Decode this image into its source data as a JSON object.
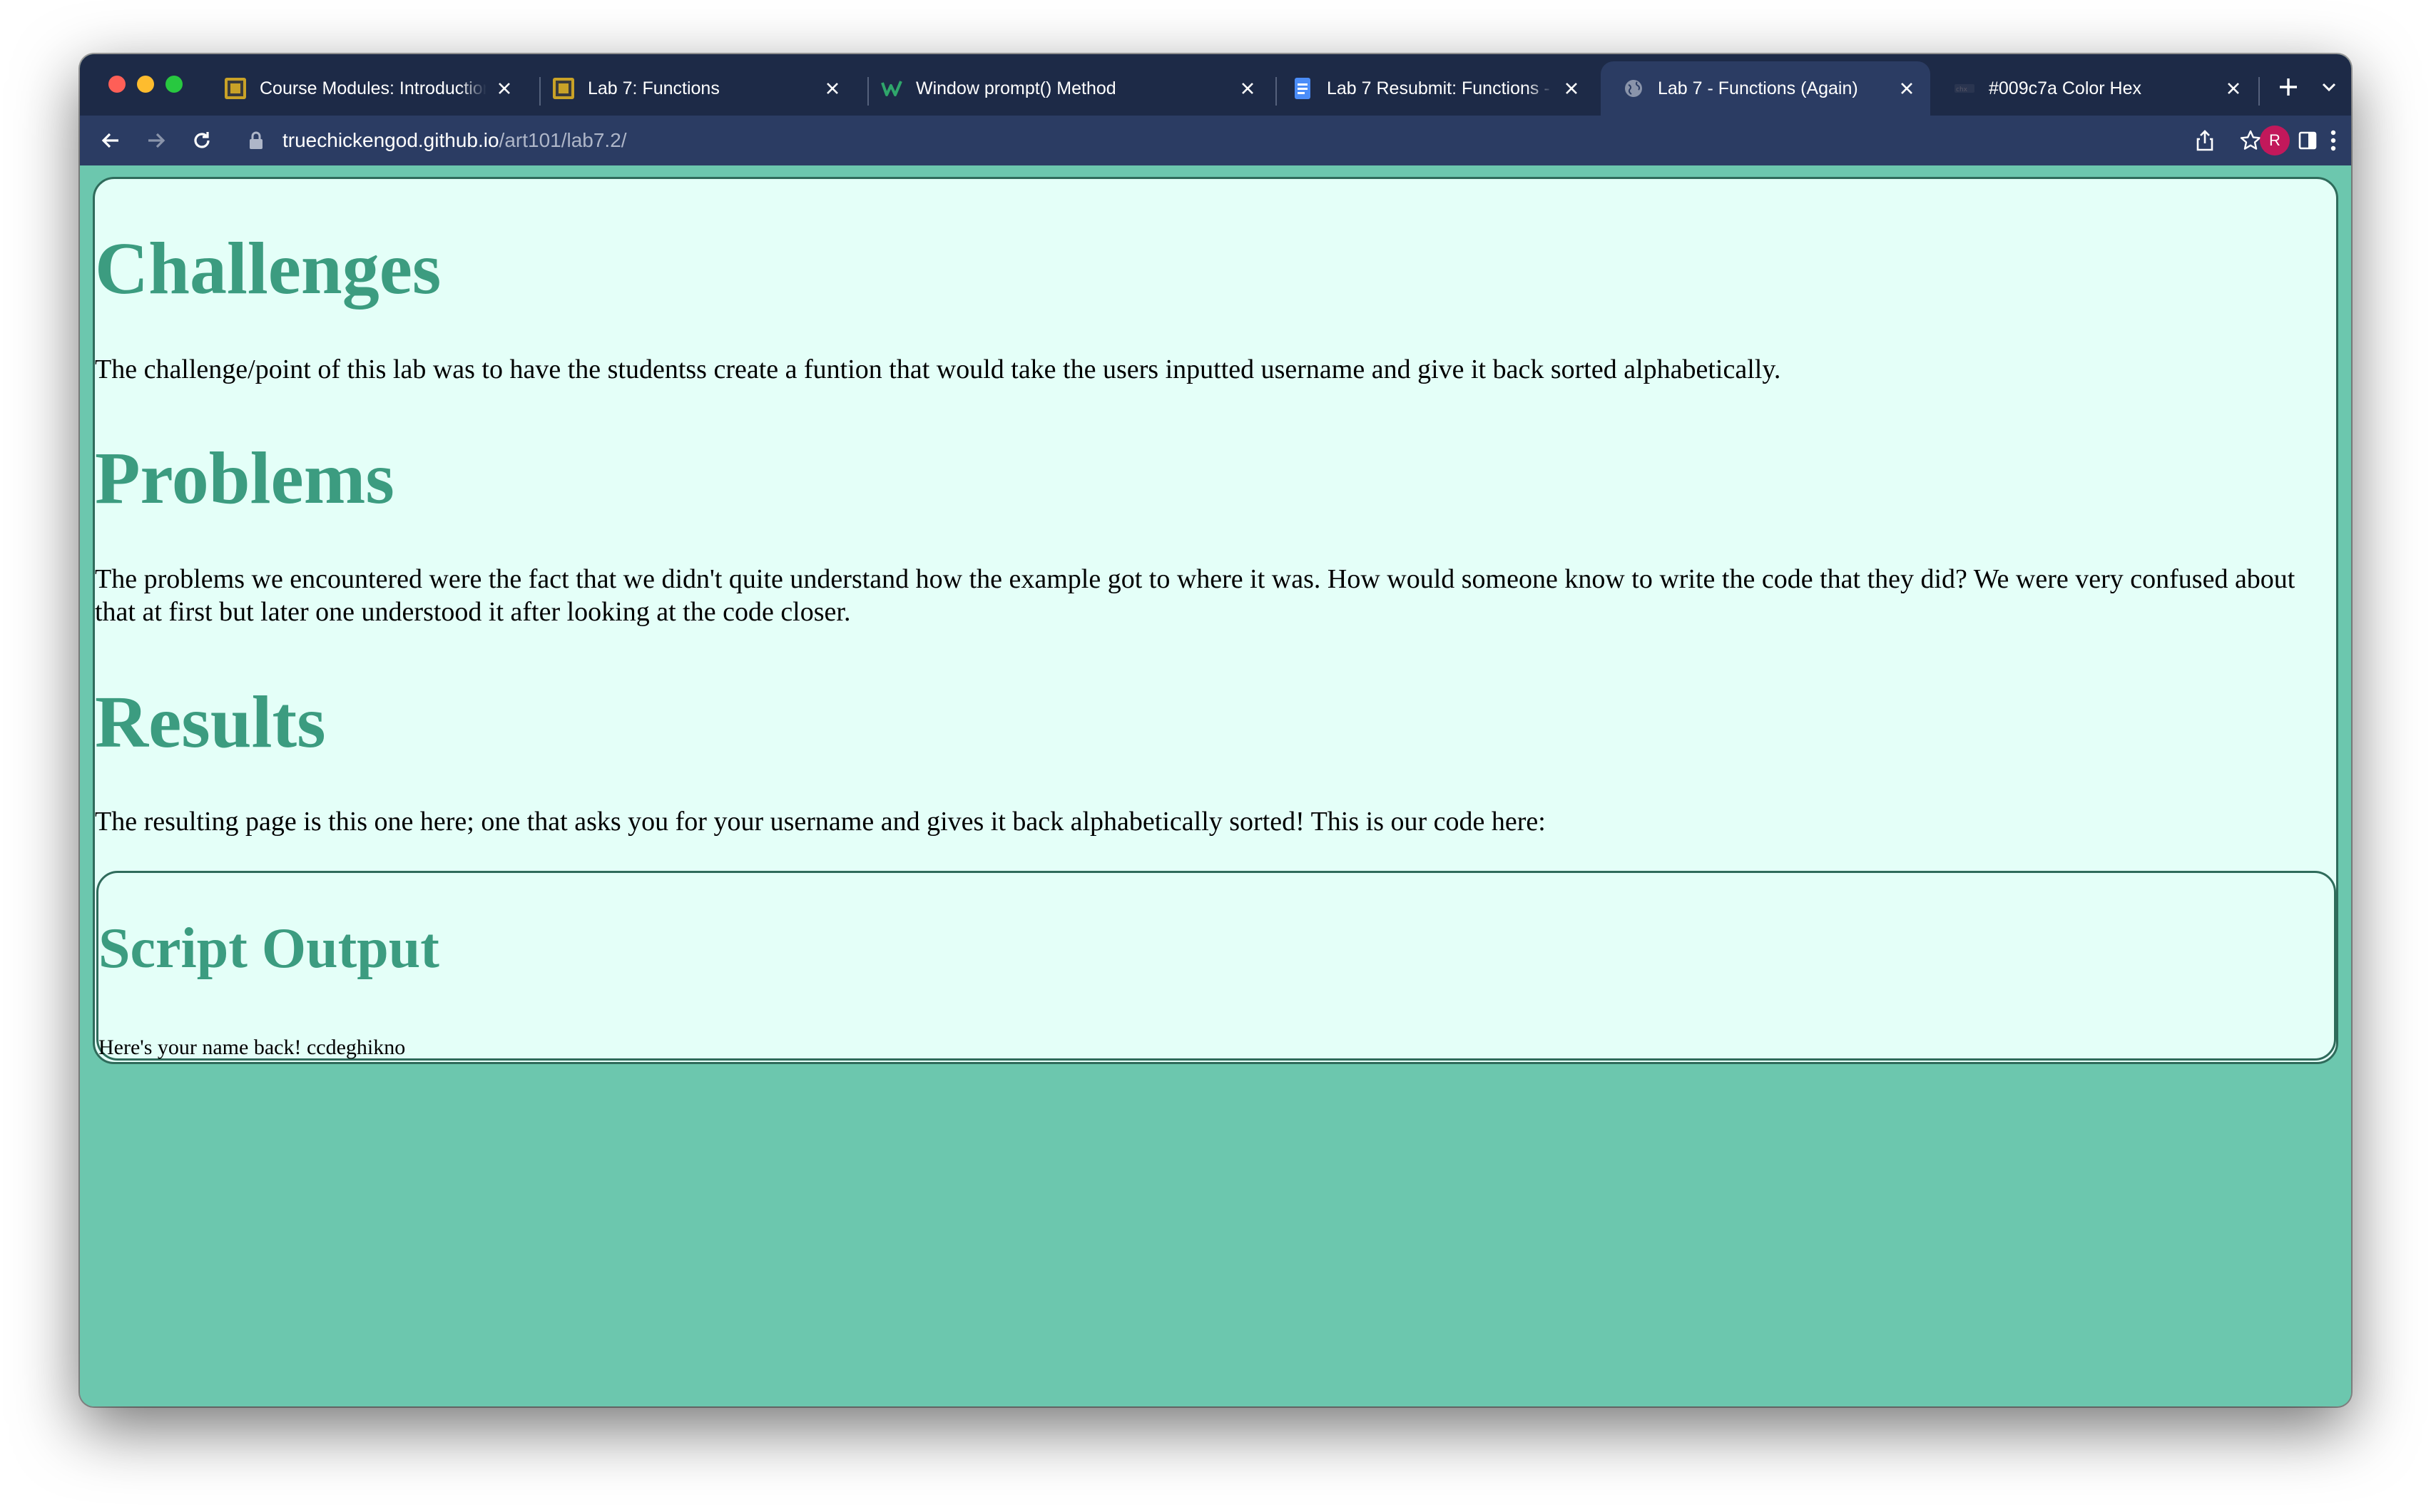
{
  "browser": {
    "tabs": [
      {
        "title": "Course Modules: Introduction",
        "favicon": "course-logo-icon",
        "active": false
      },
      {
        "title": "Lab 7: Functions",
        "favicon": "course-logo-icon",
        "active": false
      },
      {
        "title": "Window prompt() Method",
        "favicon": "w3schools-icon",
        "active": false
      },
      {
        "title": "Lab 7 Resubmit: Functions - Google Docs",
        "favicon": "docs-icon",
        "active": false
      },
      {
        "title": "Lab 7 - Functions (Again)",
        "favicon": "globe-icon",
        "active": true
      },
      {
        "title": "#009c7a Color Hex",
        "favicon": "colorhex-icon",
        "active": false
      }
    ],
    "url": {
      "host": "truechickengod.github.io",
      "path": "/art101/lab7.2/"
    },
    "profile_initial": "R"
  },
  "page": {
    "sections": [
      {
        "heading": "Challenges",
        "text": "The challenge/point of this lab was to have the studentss create a funtion that would take the users inputted username and give it back sorted alphabetically."
      },
      {
        "heading": "Problems",
        "text": "The problems we encountered were the fact that we didn't quite understand how the example got to where it was. How would someone know to write the code that they did? We were very confused about that at first but later one understood it after looking at the code closer."
      },
      {
        "heading": "Results",
        "text": "The resulting page is this one here; one that asks you for your username and gives it back alphabetically sorted! This is our code here:"
      }
    ],
    "script_output": {
      "heading": "Script Output",
      "text": "Here's your name back! ccdeghikno"
    }
  },
  "colors": {
    "page_bg": "#6cc7ae",
    "card_bg": "#e4fff8",
    "heading": "#3c9c80",
    "border": "#2f6b5b",
    "tabstrip_bg": "#1d2a47",
    "toolbar_bg": "#2b3c63"
  }
}
